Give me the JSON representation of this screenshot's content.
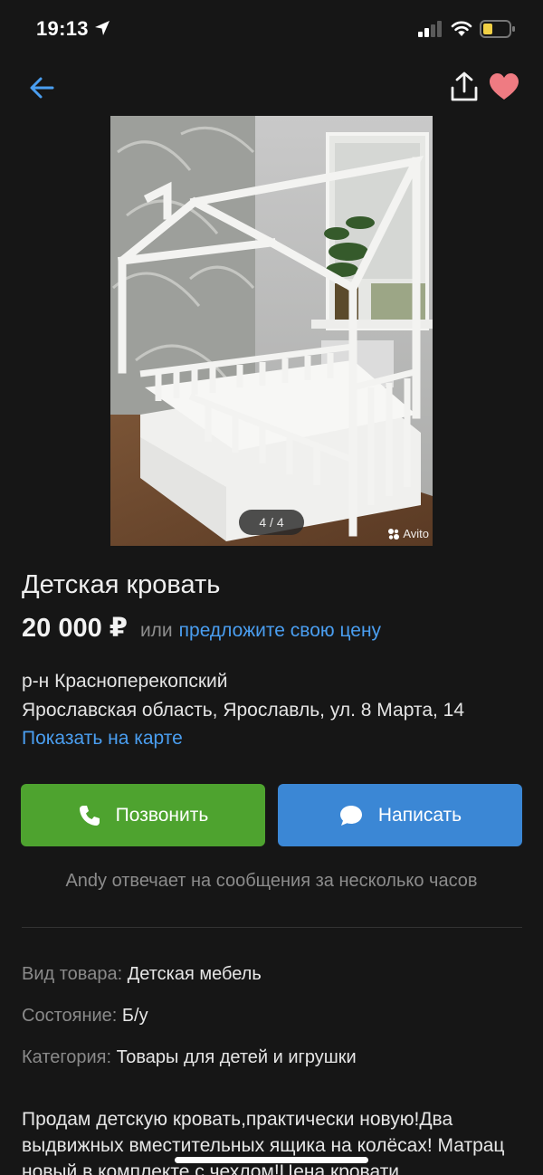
{
  "status_bar": {
    "time": "19:13"
  },
  "gallery": {
    "counter": "4 / 4",
    "watermark": "Avito"
  },
  "listing": {
    "title": "Детская кровать",
    "price": "20 000 ₽",
    "price_or": "или",
    "price_offer": "предложите свою цену",
    "district": "р-н Красноперекопский",
    "address": "Ярославская область, Ярославль, ул. 8 Марта, 14",
    "map_link": "Показать на карте"
  },
  "actions": {
    "call_label": "Позвонить",
    "write_label": "Написать"
  },
  "seller_note": "Andy отвечает на сообщения за несколько часов",
  "params": [
    {
      "key": "Вид товара:",
      "value": "Детская мебель"
    },
    {
      "key": "Состояние:",
      "value": "Б/у"
    },
    {
      "key": "Категория:",
      "value": "Товары для детей и игрушки"
    }
  ],
  "description": "Продам детскую кровать,практически новую!Два выдвижных вместительных ящика на колёсах! Матрац новый в комплекте с чехлом!Цена кровати",
  "colors": {
    "accent": "#4a9ef0",
    "call": "#4ea32f",
    "write": "#3b87d5",
    "favorite": "#ef7b82"
  }
}
